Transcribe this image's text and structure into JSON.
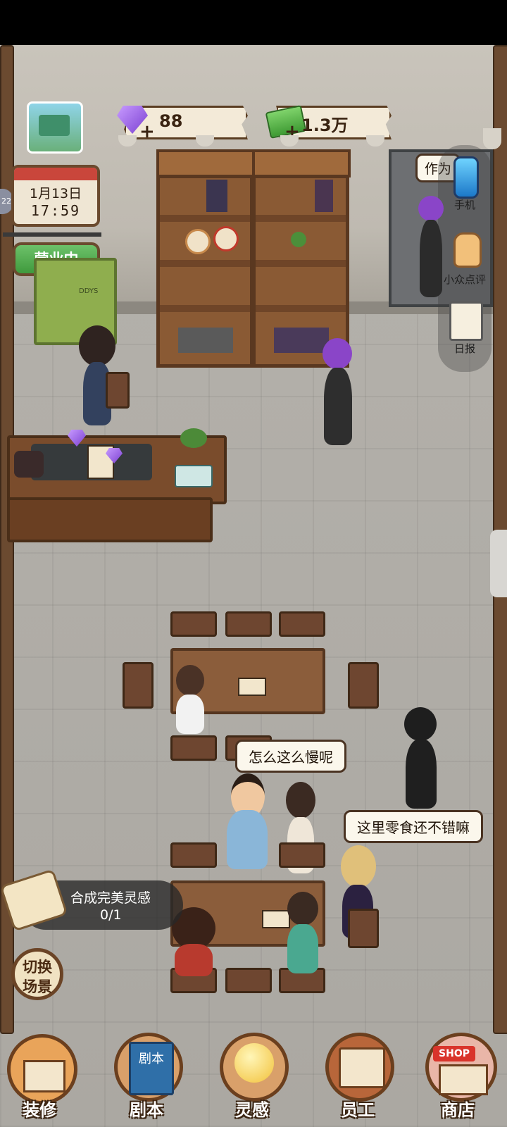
{
  "resources": {
    "gems": "88",
    "cash": "1.3万",
    "gem_icon": "purple-gem-icon",
    "cash_icon": "cash-stack-icon"
  },
  "calendar": {
    "date": "1月13日",
    "time": "17:59"
  },
  "status_sign": {
    "label": "营业中"
  },
  "cabinet": {
    "label": "DDYS"
  },
  "side_menu": {
    "items": [
      {
        "label": "手机",
        "icon": "phone-icon"
      },
      {
        "label": "小众点评",
        "icon": "thumbs-up-icon"
      },
      {
        "label": "日报",
        "icon": "report-clipboard-icon"
      }
    ]
  },
  "wall_sign": {
    "text": "作为"
  },
  "speech": {
    "bubble_1": "怎么这么慢呢",
    "bubble_2": "这里零食还不错嘛"
  },
  "task": {
    "title": "合成完美灵感",
    "progress": "0/1"
  },
  "scene_switch": {
    "label_line1": "切换",
    "label_line2": "场景"
  },
  "bottom_nav": {
    "items": [
      {
        "label": "装修",
        "icon": "house-icon"
      },
      {
        "label": "剧本",
        "icon": "script-book-icon"
      },
      {
        "label": "灵感",
        "icon": "lightbulb-icon"
      },
      {
        "label": "员工",
        "icon": "staff-badge-icon"
      },
      {
        "label": "商店",
        "icon": "shop-icon"
      }
    ],
    "script_book_text": "剧本",
    "shop_sign_text": "SHOP"
  },
  "edge_tab": {
    "text": "22"
  },
  "colors": {
    "accent_brown": "#5a3d22",
    "gem_purple": "#7a3fd1",
    "cash_green": "#3e9a33",
    "open_green": "#3f9a3d"
  }
}
